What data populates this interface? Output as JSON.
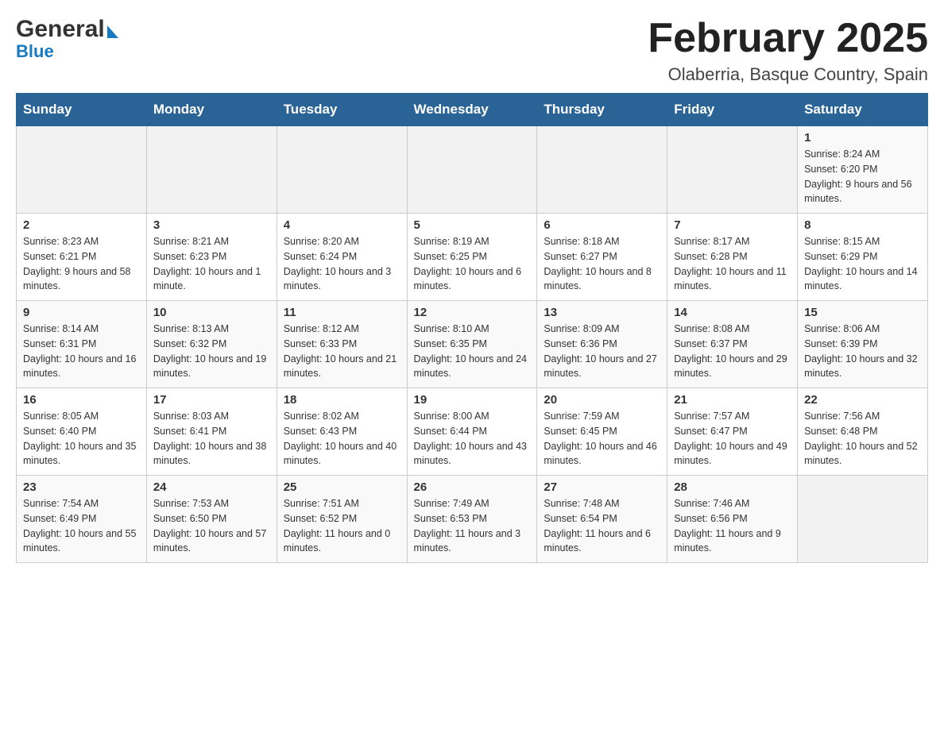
{
  "header": {
    "logo_general": "General",
    "logo_blue": "Blue",
    "title": "February 2025",
    "subtitle": "Olaberria, Basque Country, Spain"
  },
  "days_of_week": [
    "Sunday",
    "Monday",
    "Tuesday",
    "Wednesday",
    "Thursday",
    "Friday",
    "Saturday"
  ],
  "weeks": [
    [
      {
        "day": "",
        "info": ""
      },
      {
        "day": "",
        "info": ""
      },
      {
        "day": "",
        "info": ""
      },
      {
        "day": "",
        "info": ""
      },
      {
        "day": "",
        "info": ""
      },
      {
        "day": "",
        "info": ""
      },
      {
        "day": "1",
        "info": "Sunrise: 8:24 AM\nSunset: 6:20 PM\nDaylight: 9 hours and 56 minutes."
      }
    ],
    [
      {
        "day": "2",
        "info": "Sunrise: 8:23 AM\nSunset: 6:21 PM\nDaylight: 9 hours and 58 minutes."
      },
      {
        "day": "3",
        "info": "Sunrise: 8:21 AM\nSunset: 6:23 PM\nDaylight: 10 hours and 1 minute."
      },
      {
        "day": "4",
        "info": "Sunrise: 8:20 AM\nSunset: 6:24 PM\nDaylight: 10 hours and 3 minutes."
      },
      {
        "day": "5",
        "info": "Sunrise: 8:19 AM\nSunset: 6:25 PM\nDaylight: 10 hours and 6 minutes."
      },
      {
        "day": "6",
        "info": "Sunrise: 8:18 AM\nSunset: 6:27 PM\nDaylight: 10 hours and 8 minutes."
      },
      {
        "day": "7",
        "info": "Sunrise: 8:17 AM\nSunset: 6:28 PM\nDaylight: 10 hours and 11 minutes."
      },
      {
        "day": "8",
        "info": "Sunrise: 8:15 AM\nSunset: 6:29 PM\nDaylight: 10 hours and 14 minutes."
      }
    ],
    [
      {
        "day": "9",
        "info": "Sunrise: 8:14 AM\nSunset: 6:31 PM\nDaylight: 10 hours and 16 minutes."
      },
      {
        "day": "10",
        "info": "Sunrise: 8:13 AM\nSunset: 6:32 PM\nDaylight: 10 hours and 19 minutes."
      },
      {
        "day": "11",
        "info": "Sunrise: 8:12 AM\nSunset: 6:33 PM\nDaylight: 10 hours and 21 minutes."
      },
      {
        "day": "12",
        "info": "Sunrise: 8:10 AM\nSunset: 6:35 PM\nDaylight: 10 hours and 24 minutes."
      },
      {
        "day": "13",
        "info": "Sunrise: 8:09 AM\nSunset: 6:36 PM\nDaylight: 10 hours and 27 minutes."
      },
      {
        "day": "14",
        "info": "Sunrise: 8:08 AM\nSunset: 6:37 PM\nDaylight: 10 hours and 29 minutes."
      },
      {
        "day": "15",
        "info": "Sunrise: 8:06 AM\nSunset: 6:39 PM\nDaylight: 10 hours and 32 minutes."
      }
    ],
    [
      {
        "day": "16",
        "info": "Sunrise: 8:05 AM\nSunset: 6:40 PM\nDaylight: 10 hours and 35 minutes."
      },
      {
        "day": "17",
        "info": "Sunrise: 8:03 AM\nSunset: 6:41 PM\nDaylight: 10 hours and 38 minutes."
      },
      {
        "day": "18",
        "info": "Sunrise: 8:02 AM\nSunset: 6:43 PM\nDaylight: 10 hours and 40 minutes."
      },
      {
        "day": "19",
        "info": "Sunrise: 8:00 AM\nSunset: 6:44 PM\nDaylight: 10 hours and 43 minutes."
      },
      {
        "day": "20",
        "info": "Sunrise: 7:59 AM\nSunset: 6:45 PM\nDaylight: 10 hours and 46 minutes."
      },
      {
        "day": "21",
        "info": "Sunrise: 7:57 AM\nSunset: 6:47 PM\nDaylight: 10 hours and 49 minutes."
      },
      {
        "day": "22",
        "info": "Sunrise: 7:56 AM\nSunset: 6:48 PM\nDaylight: 10 hours and 52 minutes."
      }
    ],
    [
      {
        "day": "23",
        "info": "Sunrise: 7:54 AM\nSunset: 6:49 PM\nDaylight: 10 hours and 55 minutes."
      },
      {
        "day": "24",
        "info": "Sunrise: 7:53 AM\nSunset: 6:50 PM\nDaylight: 10 hours and 57 minutes."
      },
      {
        "day": "25",
        "info": "Sunrise: 7:51 AM\nSunset: 6:52 PM\nDaylight: 11 hours and 0 minutes."
      },
      {
        "day": "26",
        "info": "Sunrise: 7:49 AM\nSunset: 6:53 PM\nDaylight: 11 hours and 3 minutes."
      },
      {
        "day": "27",
        "info": "Sunrise: 7:48 AM\nSunset: 6:54 PM\nDaylight: 11 hours and 6 minutes."
      },
      {
        "day": "28",
        "info": "Sunrise: 7:46 AM\nSunset: 6:56 PM\nDaylight: 11 hours and 9 minutes."
      },
      {
        "day": "",
        "info": ""
      }
    ]
  ]
}
